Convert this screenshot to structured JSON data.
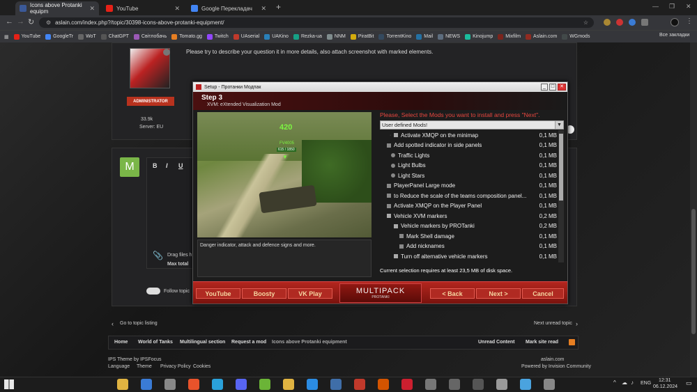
{
  "browser": {
    "tabs": [
      {
        "label": "Icons above Protanki equipm",
        "color": "#3b5998"
      },
      {
        "label": "YouTube",
        "color": "#e62117"
      },
      {
        "label": "Google Перекладач",
        "color": "#4285f4"
      }
    ],
    "new_tab": "+",
    "url": "aslain.com/index.php?/topic/30398-icons-above-protanki-equipment/",
    "bookmarks": [
      {
        "label": "YouTube",
        "color": "#e62117"
      },
      {
        "label": "GoogleTr",
        "color": "#4285f4"
      },
      {
        "label": "WoT",
        "color": "#666"
      },
      {
        "label": "ChatGPT",
        "color": "#555"
      },
      {
        "label": "Світлобачь",
        "color": "#9b59b6"
      },
      {
        "label": "Tomato.gg",
        "color": "#e67e22"
      },
      {
        "label": "Twitch",
        "color": "#9146ff"
      },
      {
        "label": "UAserial",
        "color": "#c0392b"
      },
      {
        "label": "UAKino",
        "color": "#2980b9"
      },
      {
        "label": "Rezka-ua",
        "color": "#16a085"
      },
      {
        "label": "NNM",
        "color": "#7f8c8d"
      },
      {
        "label": "PiratBit",
        "color": "#d4ac0d"
      },
      {
        "label": "TorrentKino",
        "color": "#34495e"
      },
      {
        "label": "Mail",
        "color": "#2471a3"
      },
      {
        "label": "NEWS",
        "color": "#5d6d7e"
      },
      {
        "label": "Kinojump",
        "color": "#1abc9c"
      },
      {
        "label": "Mixfilm",
        "color": "#7b241c"
      },
      {
        "label": "Aslain.com",
        "color": "#922b21"
      },
      {
        "label": "WGmods",
        "color": "#424949"
      }
    ],
    "all_bookmarks": "Все закладки"
  },
  "forum": {
    "post_text": "Please try to describe your question it in more details, also attach screenshot with marked elements.",
    "role_badge": "ADMINISTRATOR",
    "reputation": "33.9k",
    "server": "Server: EU",
    "avatar_letter": "M",
    "editor": {
      "bold": "B",
      "italic": "I",
      "underline": "U"
    },
    "drag_text": "Drag files h",
    "max_total": "Max total",
    "follow_topic": "Follow topic",
    "go_to_topic_listing": "Go to topic listing",
    "next_unread": "Next unread topic",
    "breadcrumbs": [
      "Home",
      "World of Tanks",
      "Multilingual section",
      "Request a mod",
      "Icons above Protanki equipment"
    ],
    "unread_content": "Unread Content",
    "mark_site_read": "Mark site read",
    "footer": {
      "theme": "IPS Theme by IPSFocus",
      "language": "Language",
      "theme_link": "Theme",
      "privacy": "Privacy Policy",
      "cookies": "Cookies",
      "site": "aslain.com",
      "powered": "Powered by Invision Community"
    }
  },
  "setup": {
    "window_title": "Setup - Протанки Модпак",
    "step": "Step 3",
    "subtitle": "XVM: eXtended Visualization Mod",
    "preview": {
      "score": "420",
      "tank_name": "FV4005",
      "tank_hp": "615 / 1850"
    },
    "description": "Danger indicator, attack and defence signs and more.",
    "instruction": "Please, Select the Mods you want to install and press \"Next\".",
    "dropdown": "User defined Mods!",
    "mods": [
      {
        "label": "Activate XMQP on the minimap",
        "size": "0,1 MB",
        "indent": 2
      },
      {
        "label": "Add spotted indicator in side panels",
        "size": "0,1 MB",
        "indent": 0
      },
      {
        "label": "Traffic Lights",
        "size": "0,1 MB",
        "indent": 1
      },
      {
        "label": "Light Bulbs",
        "size": "0,1 MB",
        "indent": 1
      },
      {
        "label": "Light Stars",
        "size": "0,1 MB",
        "indent": 1
      },
      {
        "label": "PlayerPanel Large mode",
        "size": "0,1 MB",
        "indent": 0
      },
      {
        "label": "to Reduce the scale of the teams composition panel...",
        "size": "0,1 MB",
        "indent": 0
      },
      {
        "label": "Activate XMQP on the Player Panel",
        "size": "0,1 MB",
        "indent": 0
      },
      {
        "label": "Vehicle XVM markers",
        "size": "0,2 MB",
        "indent": 0
      },
      {
        "label": "Vehicle markers by PROTanki",
        "size": "0,2 MB",
        "indent": 1
      },
      {
        "label": "Mark Shell damage",
        "size": "0,1 MB",
        "indent": 2
      },
      {
        "label": "Add nicknames",
        "size": "0,1 MB",
        "indent": 2
      },
      {
        "label": "Turn off alternative vehicle markers",
        "size": "0,1 MB",
        "indent": 1
      }
    ],
    "disk_space": "Current selection requires at least 23,5 MB of disk space.",
    "buttons": {
      "youtube": "YouTube",
      "boosty": "Boosty",
      "vkplay": "VK Play",
      "back": "< Back",
      "next": "Next >",
      "cancel": "Cancel"
    },
    "logo_main": "MULTIPACK",
    "logo_sub": "PROTANKI"
  },
  "taskbar": {
    "lang": "ENG",
    "time": "12:31",
    "date": "06.12.2024",
    "icons": [
      {
        "name": "file-explorer-icon",
        "color": "#e0b341"
      },
      {
        "name": "store-icon",
        "color": "#3a7bd5"
      },
      {
        "name": "photos-icon",
        "color": "#888"
      },
      {
        "name": "dts-icon",
        "color": "#e8532b"
      },
      {
        "name": "telegram-icon",
        "color": "#2aa1da"
      },
      {
        "name": "discord-icon",
        "color": "#5865f2"
      },
      {
        "name": "utorrent-icon",
        "color": "#6bb437"
      },
      {
        "name": "chrome-icon",
        "color": "#e0b341"
      },
      {
        "name": "play-icon",
        "color": "#2b8ce3"
      },
      {
        "name": "equalizer-icon",
        "color": "#3f6ea8"
      },
      {
        "name": "app64-icon",
        "color": "#c0392b"
      },
      {
        "name": "ccleaner-icon",
        "color": "#d35400"
      },
      {
        "name": "opera-icon",
        "color": "#cc1f2f"
      },
      {
        "name": "plane-icon",
        "color": "#777"
      },
      {
        "name": "wot-icon",
        "color": "#666"
      },
      {
        "name": "wot2-icon",
        "color": "#555"
      },
      {
        "name": "settings-icon",
        "color": "#999"
      },
      {
        "name": "window-app-icon",
        "color": "#4aa3df"
      },
      {
        "name": "setup-app-icon",
        "color": "#888"
      }
    ]
  }
}
